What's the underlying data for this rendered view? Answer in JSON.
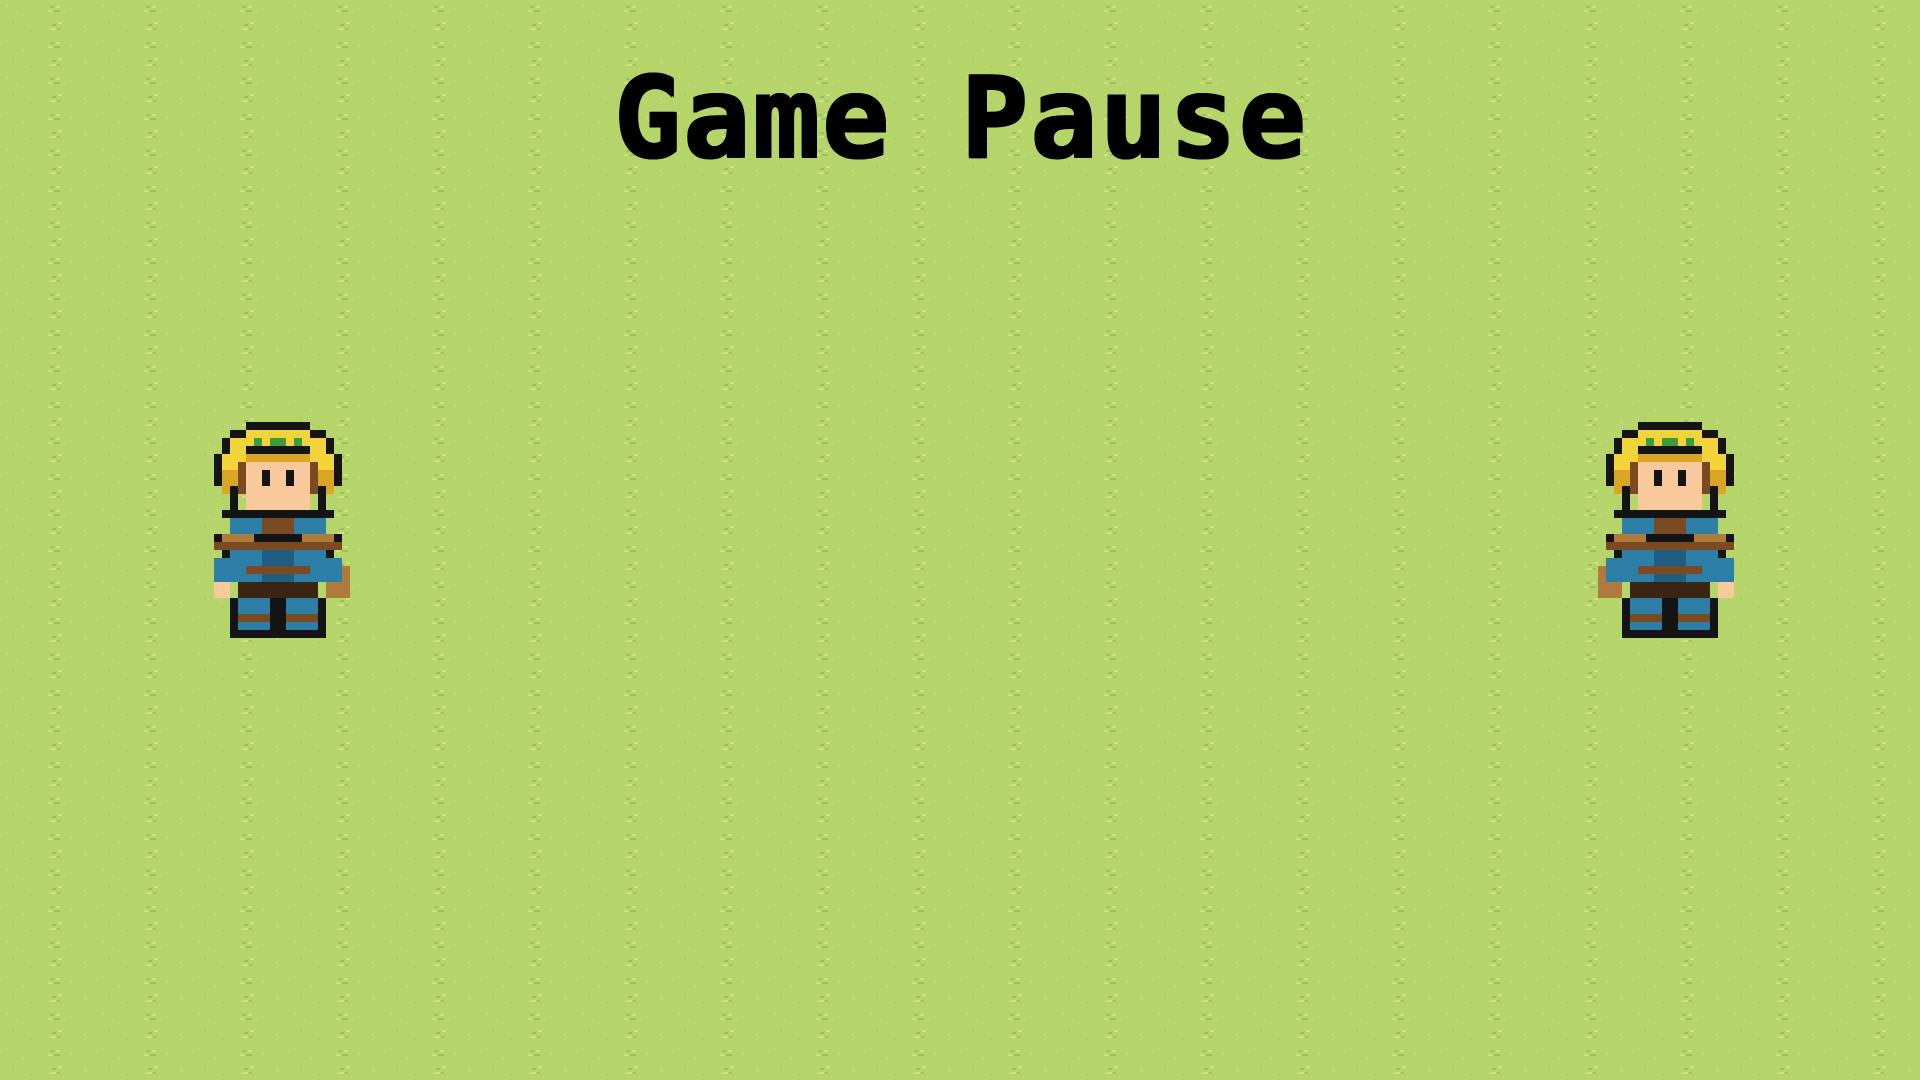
{
  "screen": {
    "title": "Game Pause"
  },
  "palette": {
    "grass": "#b5d46a",
    "grass_light": "#cde07a",
    "grass_dark": "#8cbc58",
    "hair": "#f2d33a",
    "hair_shade": "#d8a624",
    "band": "#3e9a3a",
    "skin": "#f8c99a",
    "tunic": "#2d7fa8",
    "leather": "#7a4a22",
    "leather_light": "#b07a3c",
    "outline": "#141414"
  },
  "sprites": [
    {
      "name": "hero-left",
      "facing": "right"
    },
    {
      "name": "hero-right",
      "facing": "left"
    }
  ]
}
